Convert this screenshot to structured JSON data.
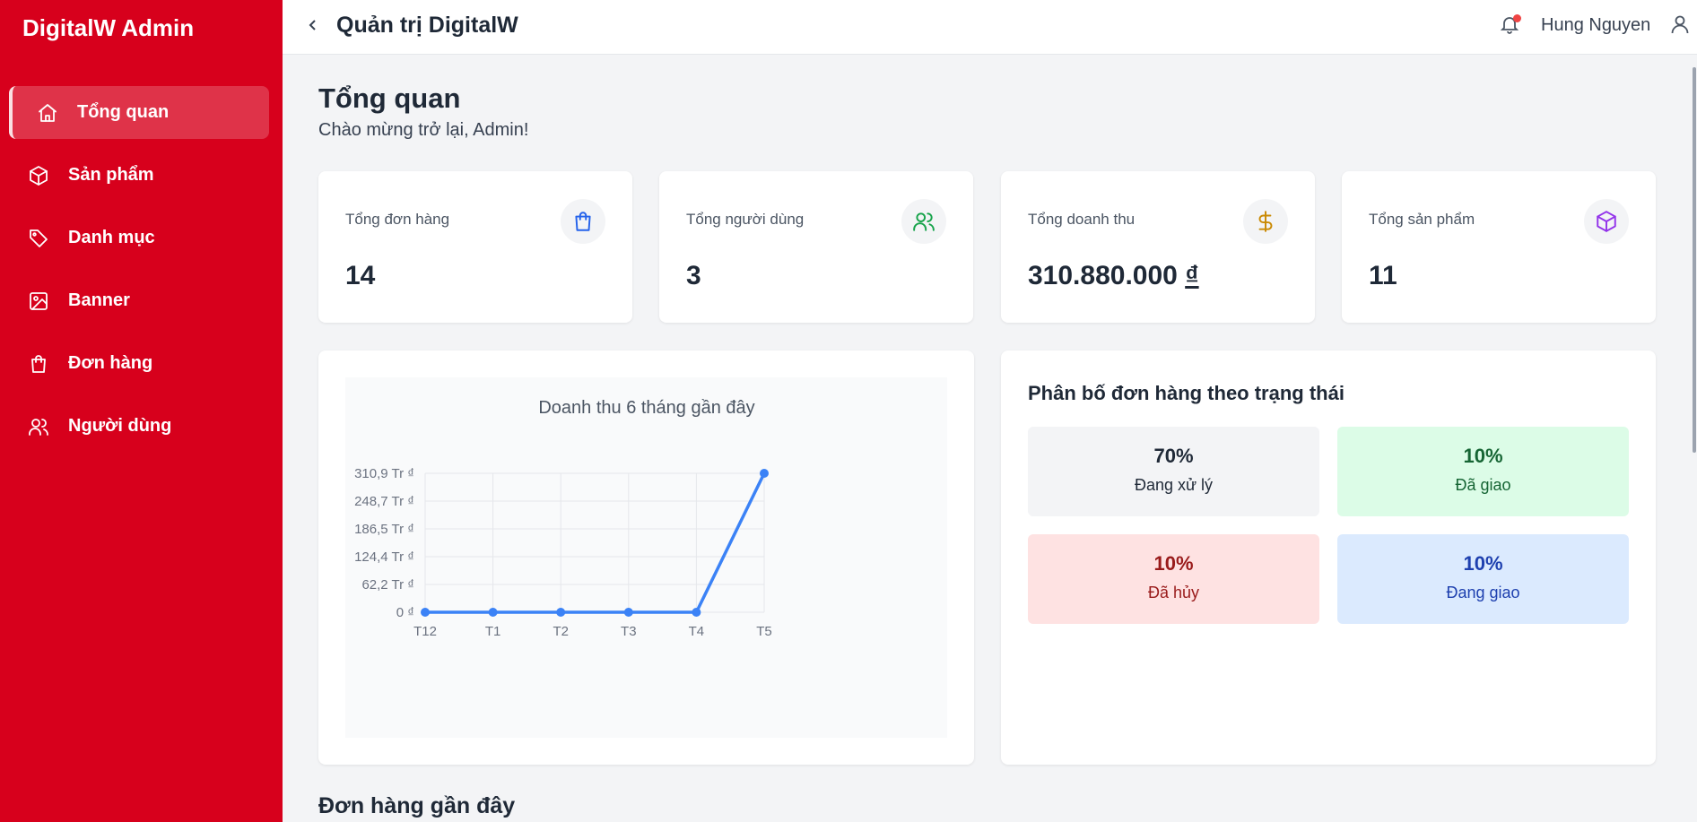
{
  "sidebar": {
    "brand": "DigitalW Admin",
    "items": [
      {
        "label": "Tổng quan",
        "icon": "home-icon"
      },
      {
        "label": "Sản phẩm",
        "icon": "box-icon"
      },
      {
        "label": "Danh mục",
        "icon": "tag-icon"
      },
      {
        "label": "Banner",
        "icon": "image-icon"
      },
      {
        "label": "Đơn hàng",
        "icon": "shopping-bag-icon"
      },
      {
        "label": "Người dùng",
        "icon": "users-icon"
      }
    ],
    "color": "#d7001c"
  },
  "header": {
    "title": "Quản trị DigitalW",
    "user_name": "Hung Nguyen"
  },
  "page": {
    "title": "Tổng quan",
    "subtitle": "Chào mừng trở lại, Admin!"
  },
  "stats": [
    {
      "label": "Tổng đơn hàng",
      "value": "14",
      "icon": "shopping-bag-icon",
      "color": "#2563eb"
    },
    {
      "label": "Tổng người dùng",
      "value": "3",
      "icon": "users-icon",
      "color": "#16a34a"
    },
    {
      "label": "Tổng doanh thu",
      "value": "310.880.000",
      "currency": "₫",
      "icon": "dollar-icon",
      "color": "#ca8a04"
    },
    {
      "label": "Tổng sản phẩm",
      "value": "11",
      "icon": "box-icon",
      "color": "#9333ea"
    }
  ],
  "chart_data": {
    "type": "line",
    "title": "Doanh thu 6 tháng gần đây",
    "categories": [
      "T12",
      "T1",
      "T2",
      "T3",
      "T4",
      "T5"
    ],
    "values": [
      0,
      0,
      0,
      0,
      0,
      310880000
    ],
    "y_ticks": [
      "0 ₫",
      "62,2 Tr ₫",
      "124,4 Tr ₫",
      "186,5 Tr ₫",
      "248,7 Tr ₫",
      "310,9 Tr ₫"
    ],
    "ylim": [
      0,
      310880000
    ],
    "grid": true,
    "line_color": "#3b82f6"
  },
  "status_distribution": {
    "title": "Phân bố đơn hàng theo trạng thái",
    "items": [
      {
        "percent": "70%",
        "label": "Đang xử lý",
        "bg": "#f3f4f6",
        "color": "#1f2937"
      },
      {
        "percent": "10%",
        "label": "Đã giao",
        "bg": "#dcfce7",
        "color": "#166534"
      },
      {
        "percent": "10%",
        "label": "Đã hủy",
        "bg": "#fee2e2",
        "color": "#991b1b"
      },
      {
        "percent": "10%",
        "label": "Đang giao",
        "bg": "#dbeafe",
        "color": "#1e40af"
      }
    ]
  },
  "recent_orders": {
    "title": "Đơn hàng gần đây"
  }
}
